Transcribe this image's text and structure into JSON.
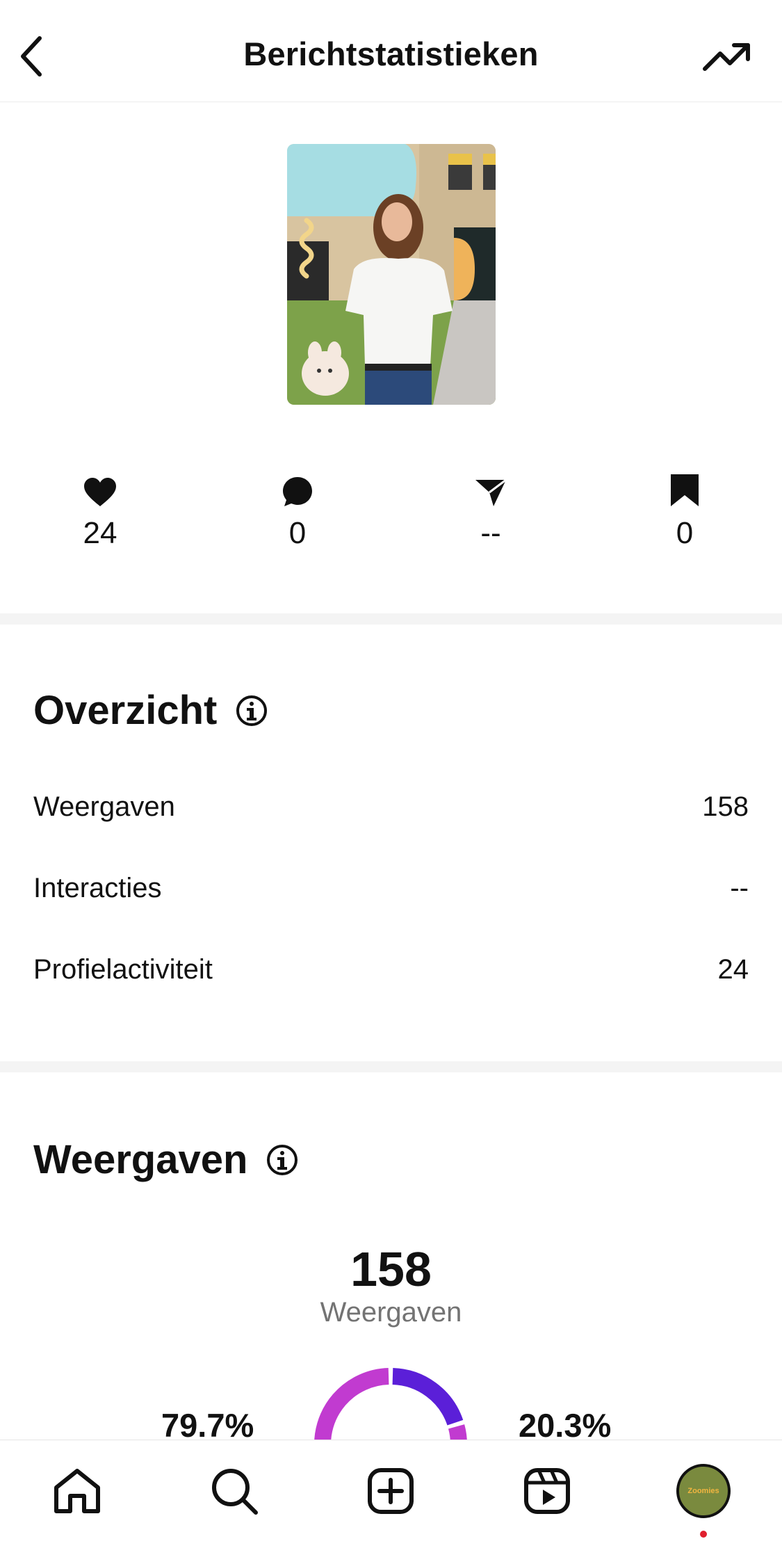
{
  "header": {
    "title": "Berichtstatistieken",
    "back_icon": "chevron-left-icon",
    "trend_icon": "trending-up-icon"
  },
  "stats": [
    {
      "icon": "heart-icon",
      "value": "24"
    },
    {
      "icon": "comment-icon",
      "value": "0"
    },
    {
      "icon": "share-icon",
      "value": "--"
    },
    {
      "icon": "bookmark-icon",
      "value": "0"
    }
  ],
  "overview": {
    "title": "Overzicht",
    "rows": [
      {
        "label": "Weergaven",
        "value": "158"
      },
      {
        "label": "Interacties",
        "value": "--"
      },
      {
        "label": "Profielactiviteit",
        "value": "24"
      }
    ]
  },
  "views": {
    "title": "Weergaven",
    "total": "158",
    "total_label": "Weergaven",
    "left_pct": "79.7%",
    "right_pct": "20.3%"
  },
  "chart_data": {
    "type": "pie",
    "categories": [
      "79.7%",
      "20.3%"
    ],
    "values": [
      79.7,
      20.3
    ],
    "colors": [
      "#c13bd0",
      "#5b1fd8"
    ]
  },
  "nav": {
    "items": [
      "home-icon",
      "search-icon",
      "create-icon",
      "reels-icon",
      "profile-avatar"
    ],
    "avatar_text": "Zoomies"
  }
}
